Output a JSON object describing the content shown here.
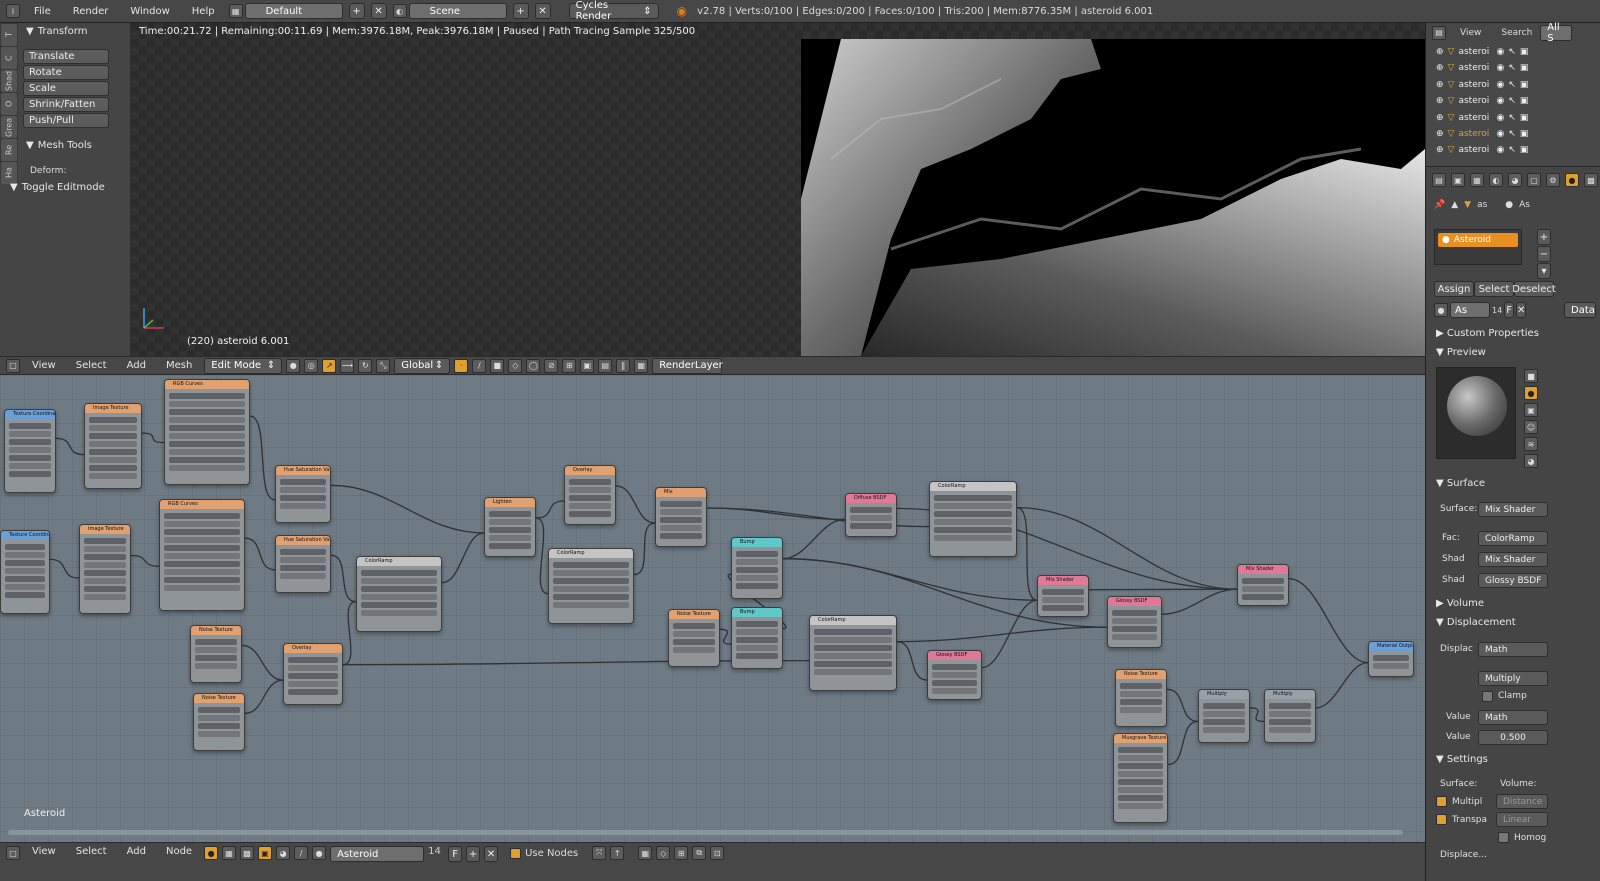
{
  "topbar": {
    "menus": [
      "File",
      "Render",
      "Window",
      "Help"
    ],
    "screen_layout": "Default",
    "scene": "Scene",
    "render_engine": "Cycles Render",
    "stats": "v2.78 | Verts:0/100 | Edges:0/200 | Faces:0/100 | Tris:200 | Mem:8776.35M | asteroid 6.001"
  },
  "toolshelf": {
    "tabs": [
      "T",
      "C",
      "Shad",
      "O",
      "Grea",
      "Re",
      "Ha"
    ],
    "transform_title": "Transform",
    "buttons": [
      "Translate",
      "Rotate",
      "Scale",
      "Shrink/Fatten",
      "Push/Pull"
    ],
    "mesh_tools_title": "Mesh Tools",
    "deform_label": "Deform:",
    "toggle_editmode": "Toggle Editmode"
  },
  "viewport": {
    "status": "Time:00:21.72 | Remaining:00:11.69 | Mem:3976.18M, Peak:3976.18M | Paused | Path Tracing Sample 325/500",
    "object_label": "(220) asteroid 6.001"
  },
  "header3d": {
    "menus": [
      "View",
      "Select",
      "Add",
      "Mesh"
    ],
    "mode": "Edit Mode",
    "orientation": "Global",
    "render_layer": "RenderLayer"
  },
  "node_editor": {
    "label": "Asteroid",
    "nodes": [
      {
        "id": "tc1",
        "title": "Texture Coordinate",
        "color": "#6a9fd8"
      },
      {
        "id": "it1",
        "title": "Image Texture",
        "color": "#e0a070"
      },
      {
        "id": "rgb1",
        "title": "RGB Curves",
        "color": "#e0a070"
      },
      {
        "id": "hsv1",
        "title": "Hue Saturation Value",
        "color": "#e0a070"
      },
      {
        "id": "tc2",
        "title": "Texture Coordinate",
        "color": "#6a9fd8"
      },
      {
        "id": "it2",
        "title": "Image Texture",
        "color": "#e0a070"
      },
      {
        "id": "rgb2",
        "title": "RGB Curves",
        "color": "#e0a070"
      },
      {
        "id": "hsv2",
        "title": "Hue Saturation Value",
        "color": "#e0a070"
      },
      {
        "id": "cr1",
        "title": "ColorRamp",
        "color": "#c4c4c4"
      },
      {
        "id": "light",
        "title": "Lighten",
        "color": "#e0a070"
      },
      {
        "id": "ovl1",
        "title": "Overlay",
        "color": "#e0a070"
      },
      {
        "id": "cr2",
        "title": "ColorRamp",
        "color": "#c4c4c4"
      },
      {
        "id": "mix1",
        "title": "Mix",
        "color": "#e0a070"
      },
      {
        "id": "nt1",
        "title": "Noise Texture",
        "color": "#e0a070"
      },
      {
        "id": "nt2",
        "title": "Noise Texture",
        "color": "#e0a070"
      },
      {
        "id": "ovl2",
        "title": "Overlay",
        "color": "#e0a070"
      },
      {
        "id": "bump1",
        "title": "Bump",
        "color": "#5fc8c8"
      },
      {
        "id": "nt3",
        "title": "Noise Texture",
        "color": "#e0a070"
      },
      {
        "id": "bump2",
        "title": "Bump",
        "color": "#5fc8c8"
      },
      {
        "id": "diff",
        "title": "Diffuse BSDF",
        "color": "#e07898"
      },
      {
        "id": "cr3",
        "title": "ColorRamp",
        "color": "#c4c4c4"
      },
      {
        "id": "cr4",
        "title": "ColorRamp",
        "color": "#c4c4c4"
      },
      {
        "id": "glossy1",
        "title": "Glossy BSDF",
        "color": "#e07898"
      },
      {
        "id": "mixsh1",
        "title": "Mix Shader",
        "color": "#e07898"
      },
      {
        "id": "glossy2",
        "title": "Glossy BSDF",
        "color": "#e07898"
      },
      {
        "id": "mixsh2",
        "title": "Mix Shader",
        "color": "#e07898"
      },
      {
        "id": "nt4",
        "title": "Noise Texture",
        "color": "#e0a070"
      },
      {
        "id": "musg",
        "title": "Musgrave Texture",
        "color": "#e0a070"
      },
      {
        "id": "mult1",
        "title": "Multiply",
        "color": "#9aa0a8"
      },
      {
        "id": "mult2",
        "title": "Multiply",
        "color": "#9aa0a8"
      },
      {
        "id": "out",
        "title": "Material Output",
        "color": "#6a9fd8"
      }
    ]
  },
  "header_node": {
    "menus": [
      "View",
      "Select",
      "Add",
      "Node"
    ],
    "material": "Asteroid",
    "users": "14",
    "fake_user": "F",
    "use_nodes": "Use Nodes"
  },
  "outliner": {
    "tabs": [
      "View",
      "Search",
      "All S"
    ],
    "rows": [
      "asteroi",
      "asteroi",
      "asteroi",
      "asteroi",
      "asteroi",
      "asteroi",
      "asteroi"
    ]
  },
  "properties": {
    "context_labels": [
      "as",
      "As"
    ],
    "material_slot": "Asteroid",
    "assign": "Assign",
    "select": "Select",
    "deselect": "Deselect",
    "mat_field": "As",
    "mat_users": "14",
    "mat_fake": "F",
    "data_label": "Data",
    "sections": {
      "custom": "Custom Properties",
      "preview": "Preview",
      "surface": "Surface",
      "volume": "Volume",
      "displacement": "Displacement",
      "settings": "Settings"
    },
    "surface_label": "Surface:",
    "surface_value": "Mix Shader",
    "fac_label": "Fac:",
    "fac_value": "ColorRamp",
    "shad1_label": "Shad",
    "shad1_value": "Mix Shader",
    "shad2_label": "Shad",
    "shad2_value": "Glossy BSDF",
    "displac_label": "Displac",
    "displac_value": "Math",
    "op_value": "Multiply",
    "clamp_label": "Clamp",
    "value_label": "Value",
    "value_value": "Math",
    "value2_label": "Value",
    "value2_number": "0.500",
    "settings_surface": "Surface:",
    "settings_volume": "Volume:",
    "multipl_label": "Multipl",
    "distance_value": "Distance",
    "transpa_label": "Transpa",
    "linear_value": "Linear",
    "homog_label": "Homog",
    "displace_label": "Displace..."
  }
}
